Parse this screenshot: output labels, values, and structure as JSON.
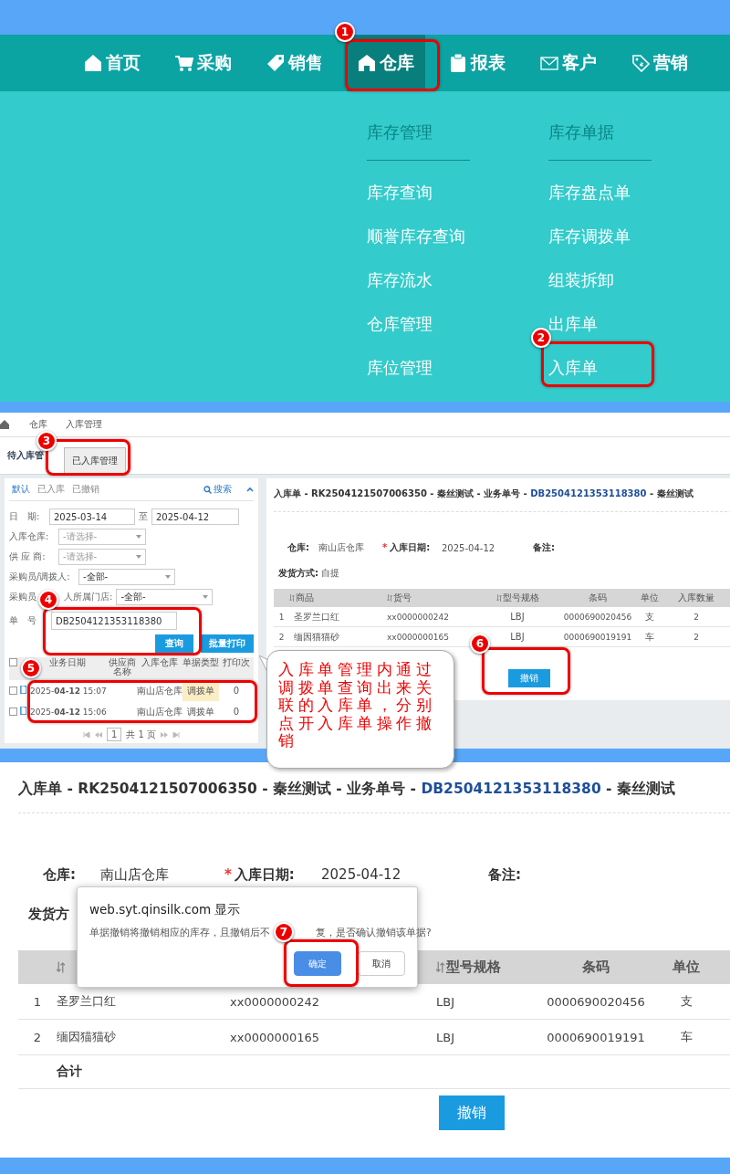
{
  "nav": {
    "items": [
      {
        "label": "首页",
        "selected": false
      },
      {
        "label": "采购",
        "selected": false
      },
      {
        "label": "销售",
        "selected": false
      },
      {
        "label": "仓库",
        "selected": true
      },
      {
        "label": "报表",
        "selected": false
      },
      {
        "label": "客户",
        "selected": false
      },
      {
        "label": "营销",
        "selected": false
      }
    ]
  },
  "menu": {
    "columns": [
      {
        "heading": "库存管理",
        "items": [
          "库存查询",
          "顺誉库存查询",
          "库存流水",
          "仓库管理",
          "库位管理"
        ]
      },
      {
        "heading": "库存单据",
        "items": [
          "库存盘点单",
          "库存调拨单",
          "组装拆卸",
          "出库单",
          "入库单"
        ]
      }
    ]
  },
  "list_screen": {
    "breadcrumb": [
      "仓库",
      "入库管理"
    ],
    "tabs": [
      {
        "label": "待入库管",
        "selected": false
      },
      {
        "label": "已入库管理",
        "selected": true
      }
    ],
    "filters": [
      {
        "label": "默认",
        "selected": true
      },
      {
        "label": "已入库",
        "selected": false
      },
      {
        "label": "已撤销",
        "selected": false
      }
    ],
    "search_link": "搜索",
    "date": {
      "label": "日　期:",
      "from": "2025-03-14",
      "separator": "至",
      "to": "2025-04-12"
    },
    "selects": [
      {
        "label": "入库仓库:",
        "placeholder": "-请选择-"
      },
      {
        "label": "供 应 商:",
        "placeholder": "-请选择-"
      },
      {
        "label": "采购员/调拨人:",
        "value": "-全部-"
      },
      {
        "label": "采购员",
        "label_rest": "人所属门店:",
        "value": "-全部-"
      }
    ],
    "order_no": {
      "label": "单　号",
      "value": "DB2504121353118380"
    },
    "buttons": [
      "查询",
      "批量打印"
    ],
    "table": {
      "header_checked": false,
      "columns": [
        "业务日期",
        "供应商名称",
        "入库仓库",
        "单据类型",
        "打印次"
      ],
      "rows": [
        {
          "checked": false,
          "date": "2025-**04-12** 15:07",
          "warehouse": "南山店仓库",
          "type": "调拨单",
          "highlighted": true,
          "prints": "0"
        },
        {
          "checked": false,
          "date": "2025-**04-12** 15:06",
          "warehouse": "南山店仓库",
          "type": "调拨单",
          "highlighted": false,
          "prints": "0"
        }
      ]
    },
    "pager": {
      "page": "1",
      "total": "共 1 页"
    }
  },
  "detail_small": {
    "title": "入库单 - RK2504121507006350 - 秦丝测试 - 业务单号 - ",
    "title_link": "DB2504121353118380",
    "title_end": " - 秦丝测试",
    "fields": [
      {
        "label": "仓库:",
        "value": "南山店仓库"
      },
      {
        "marker": "*",
        "label": "入库日期:",
        "value": "2025-04-12"
      },
      {
        "label": "备注:"
      }
    ],
    "shipping": {
      "label": "发货方式:",
      "value": "自提"
    },
    "columns": [
      {
        "label": "商品",
        "sortable": true
      },
      {
        "label": "货号",
        "sortable": true
      },
      {
        "label": "型号规格",
        "sortable": true
      },
      {
        "label": "条码",
        "sortable": false
      },
      {
        "label": "单位",
        "sortable": false
      },
      {
        "label": "入库数量",
        "sortable": false
      }
    ],
    "rows": [
      {
        "no": "1",
        "cells": [
          "圣罗兰口红",
          "xx0000000242",
          "LBJ",
          "0000690020456",
          "支",
          "2"
        ]
      },
      {
        "no": "2",
        "cells": [
          "缅因猫猫砂",
          "xx0000000165",
          "LBJ",
          "0000690019191",
          "车",
          "2"
        ]
      }
    ],
    "button": "撤销"
  },
  "callout": {
    "text": "入库单管理内通过调拨单查询出来关联的入库单，分别点开入库单操作撤销"
  },
  "detail_large": {
    "title": "入库单 - RK2504121507006350 - 秦丝测试 - 业务单号 - ",
    "title_link": "DB2504121353118380",
    "title_end": " - 秦丝测试",
    "fields": [
      {
        "label": "仓库:",
        "value": "南山店仓库"
      },
      {
        "marker": "*",
        "label": "入库日期:",
        "value": "2025-04-12"
      },
      {
        "label": "备注:"
      }
    ],
    "shipping": {
      "label": "发货方"
    },
    "columns": [
      {
        "sortable": true
      },
      {},
      {
        "label": "型号规格",
        "sortable": true
      },
      {
        "label": "条码",
        "sortable": false
      },
      {
        "label": "单位",
        "sortable": false
      }
    ],
    "rows": [
      {
        "no": "1",
        "cells": [
          "圣罗兰口红",
          "xx0000000242",
          "LBJ",
          "0000690020456",
          "支"
        ]
      },
      {
        "no": "2",
        "cells": [
          "缅因猫猫砂",
          "xx0000000165",
          "LBJ",
          "0000690019191",
          "车"
        ]
      }
    ],
    "total_label": "合计",
    "button": "撤销"
  },
  "dialog": {
    "origin": "web.syt.qinsilk.com 显示",
    "message": "单据撤销将撤销相应的库存，且撤销后不",
    "message_rest": "复，是否确认撤销该单据?",
    "buttons": [
      {
        "label": "确定",
        "kind": "primary"
      },
      {
        "label": "取消",
        "kind": "secondary"
      }
    ]
  },
  "annotations": [
    {
      "number": "1"
    },
    {
      "number": "2"
    },
    {
      "number": "3"
    },
    {
      "number": "4"
    },
    {
      "number": "5"
    },
    {
      "number": "6"
    },
    {
      "number": "7"
    }
  ]
}
